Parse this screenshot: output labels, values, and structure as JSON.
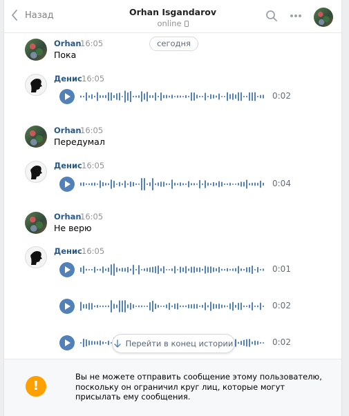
{
  "header": {
    "back_label": "Назад",
    "contact_name": "Orhan Isgandarov",
    "status": "online"
  },
  "date_pill": "сегодня",
  "messages": [
    {
      "author": "Orhan",
      "time": "16:05",
      "text": "Пока"
    },
    {
      "author": "Денис",
      "time": "16:05",
      "audio": [
        {
          "duration": "0:02"
        }
      ]
    },
    {
      "author": "Orhan",
      "time": "16:05",
      "text": "Передумал"
    },
    {
      "author": "Денис",
      "time": "16:05",
      "audio": [
        {
          "duration": "0:04"
        }
      ]
    },
    {
      "author": "Orhan",
      "time": "16:05",
      "text": "Не верю"
    },
    {
      "author": "Денис",
      "time": "16:05",
      "audio": [
        {
          "duration": "0:01"
        },
        {
          "duration": "0:02"
        },
        {
          "duration": "0:02"
        }
      ]
    }
  ],
  "goto_end_label": "Перейти в конец истории",
  "footer": {
    "icon": "!",
    "notice": "Вы не можете отправить сообщение этому пользователю, поскольку он ограничил круг лиц, которые могут присылать ему сообщения."
  },
  "colors": {
    "accent": "#5181b8",
    "author": "#2a5885",
    "warning": "#ffa000"
  }
}
